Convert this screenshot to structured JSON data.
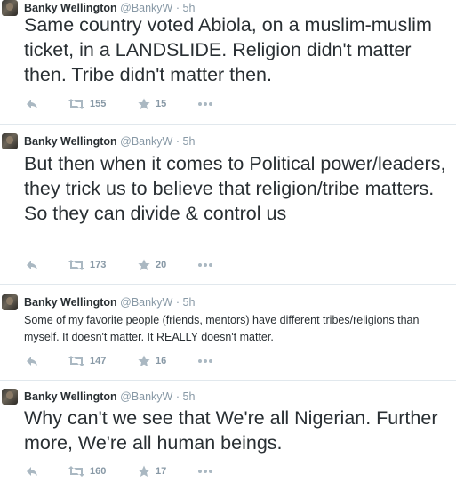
{
  "tweets": [
    {
      "author": "Banky Wellington",
      "handle": "@BankyW",
      "sep": "·",
      "time": "5h",
      "text": "Same country voted Abiola, on a muslim-muslim ticket, in a LANDSLIDE. Religion didn't matter then. Tribe didn't matter then.",
      "retweets": "155",
      "favorites": "15",
      "icons": {
        "reply": "reply-icon",
        "retweet": "retweet-icon",
        "favorite": "star-icon",
        "more": "more-icon"
      }
    },
    {
      "author": "Banky Wellington",
      "handle": "@BankyW",
      "sep": "·",
      "time": "5h",
      "text": "But then when it comes to Political power/leaders, they trick us to believe that religion/tribe matters. So they can divide & control us",
      "retweets": "173",
      "favorites": "20"
    },
    {
      "author": "Banky Wellington",
      "handle": "@BankyW",
      "sep": "·",
      "time": "5h",
      "text": "Some of my favorite people (friends, mentors) have different tribes/religions than myself. It doesn't matter. It REALLY doesn't matter.",
      "retweets": "147",
      "favorites": "16"
    },
    {
      "author": "Banky Wellington",
      "handle": "@BankyW",
      "sep": "·",
      "time": "5h",
      "text": "Why can't we see that We're all Nigerian. Further more, We're all human beings.",
      "retweets": "160",
      "favorites": "17"
    }
  ],
  "colors": {
    "text": "#292f33",
    "muted": "#8899a6",
    "icon": "#aab8c2",
    "divider": "#e1e8ed"
  }
}
